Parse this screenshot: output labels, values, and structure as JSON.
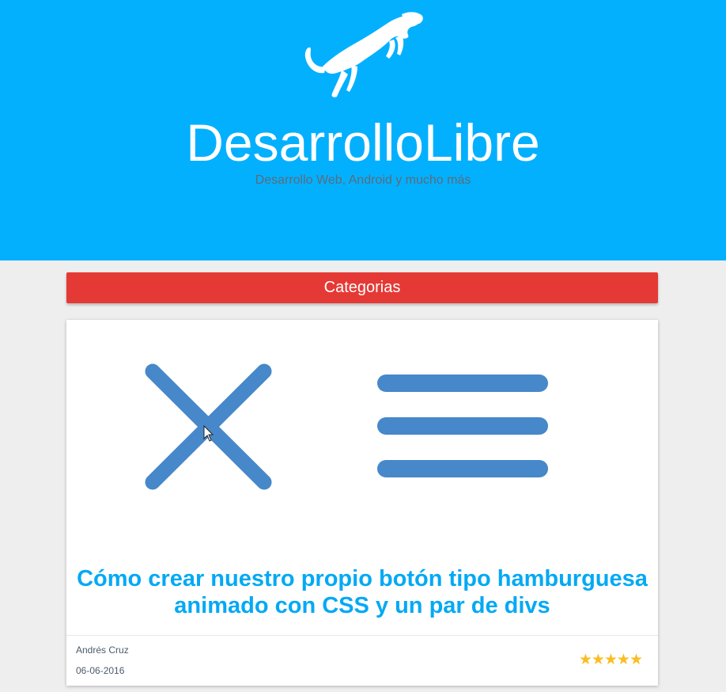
{
  "header": {
    "logo_icon": "leaping-cougar-icon",
    "site_title": "DesarrolloLibre",
    "tagline": "Desarrollo Web, Android y mucho más",
    "background": "#03b0fe"
  },
  "nav": {
    "categories_label": "Categorias",
    "color": "#e53935"
  },
  "post": {
    "image_icons": [
      "close-x-icon",
      "hamburger-menu-icon"
    ],
    "title": "Cómo crear nuestro propio botón tipo hamburguesa animado con CSS y un par de divs",
    "author": "Andrés Cruz",
    "date": "06-06-2016",
    "rating_stars": "★★★★★",
    "rating_value": 5,
    "rating_max": 5,
    "title_color": "#03a9f4",
    "star_color": "#fbbd23"
  }
}
